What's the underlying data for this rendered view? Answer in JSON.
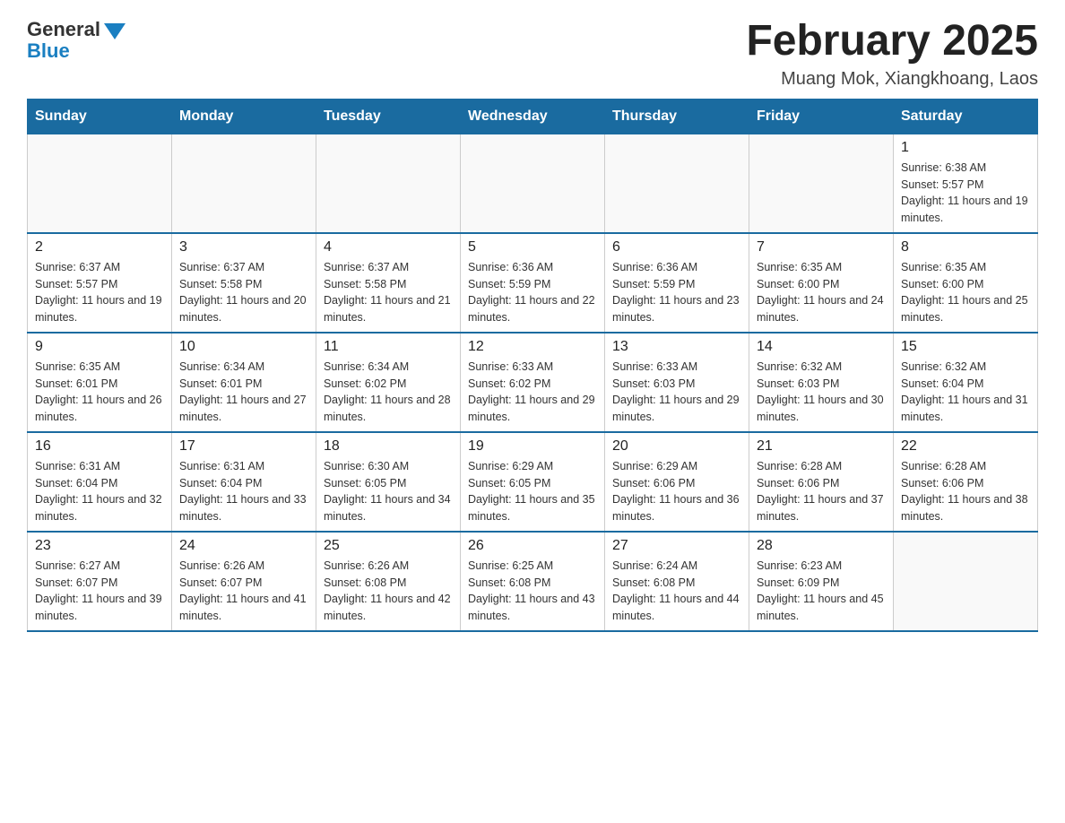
{
  "logo": {
    "general": "General",
    "blue": "Blue"
  },
  "header": {
    "title": "February 2025",
    "location": "Muang Mok, Xiangkhoang, Laos"
  },
  "weekdays": [
    "Sunday",
    "Monday",
    "Tuesday",
    "Wednesday",
    "Thursday",
    "Friday",
    "Saturday"
  ],
  "weeks": [
    [
      {
        "day": "",
        "sunrise": "",
        "sunset": "",
        "daylight": "",
        "empty": true
      },
      {
        "day": "",
        "sunrise": "",
        "sunset": "",
        "daylight": "",
        "empty": true
      },
      {
        "day": "",
        "sunrise": "",
        "sunset": "",
        "daylight": "",
        "empty": true
      },
      {
        "day": "",
        "sunrise": "",
        "sunset": "",
        "daylight": "",
        "empty": true
      },
      {
        "day": "",
        "sunrise": "",
        "sunset": "",
        "daylight": "",
        "empty": true
      },
      {
        "day": "",
        "sunrise": "",
        "sunset": "",
        "daylight": "",
        "empty": true
      },
      {
        "day": "1",
        "sunrise": "Sunrise: 6:38 AM",
        "sunset": "Sunset: 5:57 PM",
        "daylight": "Daylight: 11 hours and 19 minutes.",
        "empty": false
      }
    ],
    [
      {
        "day": "2",
        "sunrise": "Sunrise: 6:37 AM",
        "sunset": "Sunset: 5:57 PM",
        "daylight": "Daylight: 11 hours and 19 minutes.",
        "empty": false
      },
      {
        "day": "3",
        "sunrise": "Sunrise: 6:37 AM",
        "sunset": "Sunset: 5:58 PM",
        "daylight": "Daylight: 11 hours and 20 minutes.",
        "empty": false
      },
      {
        "day": "4",
        "sunrise": "Sunrise: 6:37 AM",
        "sunset": "Sunset: 5:58 PM",
        "daylight": "Daylight: 11 hours and 21 minutes.",
        "empty": false
      },
      {
        "day": "5",
        "sunrise": "Sunrise: 6:36 AM",
        "sunset": "Sunset: 5:59 PM",
        "daylight": "Daylight: 11 hours and 22 minutes.",
        "empty": false
      },
      {
        "day": "6",
        "sunrise": "Sunrise: 6:36 AM",
        "sunset": "Sunset: 5:59 PM",
        "daylight": "Daylight: 11 hours and 23 minutes.",
        "empty": false
      },
      {
        "day": "7",
        "sunrise": "Sunrise: 6:35 AM",
        "sunset": "Sunset: 6:00 PM",
        "daylight": "Daylight: 11 hours and 24 minutes.",
        "empty": false
      },
      {
        "day": "8",
        "sunrise": "Sunrise: 6:35 AM",
        "sunset": "Sunset: 6:00 PM",
        "daylight": "Daylight: 11 hours and 25 minutes.",
        "empty": false
      }
    ],
    [
      {
        "day": "9",
        "sunrise": "Sunrise: 6:35 AM",
        "sunset": "Sunset: 6:01 PM",
        "daylight": "Daylight: 11 hours and 26 minutes.",
        "empty": false
      },
      {
        "day": "10",
        "sunrise": "Sunrise: 6:34 AM",
        "sunset": "Sunset: 6:01 PM",
        "daylight": "Daylight: 11 hours and 27 minutes.",
        "empty": false
      },
      {
        "day": "11",
        "sunrise": "Sunrise: 6:34 AM",
        "sunset": "Sunset: 6:02 PM",
        "daylight": "Daylight: 11 hours and 28 minutes.",
        "empty": false
      },
      {
        "day": "12",
        "sunrise": "Sunrise: 6:33 AM",
        "sunset": "Sunset: 6:02 PM",
        "daylight": "Daylight: 11 hours and 29 minutes.",
        "empty": false
      },
      {
        "day": "13",
        "sunrise": "Sunrise: 6:33 AM",
        "sunset": "Sunset: 6:03 PM",
        "daylight": "Daylight: 11 hours and 29 minutes.",
        "empty": false
      },
      {
        "day": "14",
        "sunrise": "Sunrise: 6:32 AM",
        "sunset": "Sunset: 6:03 PM",
        "daylight": "Daylight: 11 hours and 30 minutes.",
        "empty": false
      },
      {
        "day": "15",
        "sunrise": "Sunrise: 6:32 AM",
        "sunset": "Sunset: 6:04 PM",
        "daylight": "Daylight: 11 hours and 31 minutes.",
        "empty": false
      }
    ],
    [
      {
        "day": "16",
        "sunrise": "Sunrise: 6:31 AM",
        "sunset": "Sunset: 6:04 PM",
        "daylight": "Daylight: 11 hours and 32 minutes.",
        "empty": false
      },
      {
        "day": "17",
        "sunrise": "Sunrise: 6:31 AM",
        "sunset": "Sunset: 6:04 PM",
        "daylight": "Daylight: 11 hours and 33 minutes.",
        "empty": false
      },
      {
        "day": "18",
        "sunrise": "Sunrise: 6:30 AM",
        "sunset": "Sunset: 6:05 PM",
        "daylight": "Daylight: 11 hours and 34 minutes.",
        "empty": false
      },
      {
        "day": "19",
        "sunrise": "Sunrise: 6:29 AM",
        "sunset": "Sunset: 6:05 PM",
        "daylight": "Daylight: 11 hours and 35 minutes.",
        "empty": false
      },
      {
        "day": "20",
        "sunrise": "Sunrise: 6:29 AM",
        "sunset": "Sunset: 6:06 PM",
        "daylight": "Daylight: 11 hours and 36 minutes.",
        "empty": false
      },
      {
        "day": "21",
        "sunrise": "Sunrise: 6:28 AM",
        "sunset": "Sunset: 6:06 PM",
        "daylight": "Daylight: 11 hours and 37 minutes.",
        "empty": false
      },
      {
        "day": "22",
        "sunrise": "Sunrise: 6:28 AM",
        "sunset": "Sunset: 6:06 PM",
        "daylight": "Daylight: 11 hours and 38 minutes.",
        "empty": false
      }
    ],
    [
      {
        "day": "23",
        "sunrise": "Sunrise: 6:27 AM",
        "sunset": "Sunset: 6:07 PM",
        "daylight": "Daylight: 11 hours and 39 minutes.",
        "empty": false
      },
      {
        "day": "24",
        "sunrise": "Sunrise: 6:26 AM",
        "sunset": "Sunset: 6:07 PM",
        "daylight": "Daylight: 11 hours and 41 minutes.",
        "empty": false
      },
      {
        "day": "25",
        "sunrise": "Sunrise: 6:26 AM",
        "sunset": "Sunset: 6:08 PM",
        "daylight": "Daylight: 11 hours and 42 minutes.",
        "empty": false
      },
      {
        "day": "26",
        "sunrise": "Sunrise: 6:25 AM",
        "sunset": "Sunset: 6:08 PM",
        "daylight": "Daylight: 11 hours and 43 minutes.",
        "empty": false
      },
      {
        "day": "27",
        "sunrise": "Sunrise: 6:24 AM",
        "sunset": "Sunset: 6:08 PM",
        "daylight": "Daylight: 11 hours and 44 minutes.",
        "empty": false
      },
      {
        "day": "28",
        "sunrise": "Sunrise: 6:23 AM",
        "sunset": "Sunset: 6:09 PM",
        "daylight": "Daylight: 11 hours and 45 minutes.",
        "empty": false
      },
      {
        "day": "",
        "sunrise": "",
        "sunset": "",
        "daylight": "",
        "empty": true
      }
    ]
  ]
}
